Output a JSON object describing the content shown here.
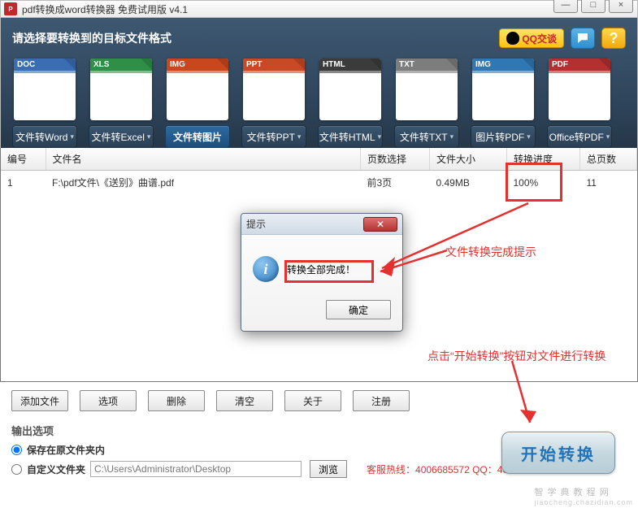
{
  "window": {
    "title": "pdf转换成word转换器 免费试用版 v4.1",
    "minimize_glyph": "—",
    "maximize_glyph": "□",
    "close_glyph": "×"
  },
  "header": {
    "title": "请选择要转换到的目标文件格式",
    "qq_label": "QQ交谈",
    "help_glyph": "?"
  },
  "formats": [
    {
      "band": "DOC",
      "band_color": "#3a6db3",
      "label": "文件转Word",
      "selected": false
    },
    {
      "band": "XLS",
      "band_color": "#2f8f47",
      "label": "文件转Excel",
      "selected": false
    },
    {
      "band": "IMG",
      "band_color": "#c8471c",
      "label": "文件转图片",
      "selected": true
    },
    {
      "band": "PPT",
      "band_color": "#c74a24",
      "label": "文件转PPT",
      "selected": false
    },
    {
      "band": "HTML",
      "band_color": "#3b3b3b",
      "label": "文件转HTML",
      "selected": false
    },
    {
      "band": "TXT",
      "band_color": "#7d7d7d",
      "label": "文件转TXT",
      "selected": false
    },
    {
      "band": "IMG",
      "band_color": "#2f78b3",
      "label": "图片转PDF",
      "selected": false
    },
    {
      "band": "PDF",
      "band_color": "#b33030",
      "label": "Office转PDF",
      "selected": false
    }
  ],
  "table": {
    "cols": {
      "num": "编号",
      "name": "文件名",
      "pages": "页数选择",
      "size": "文件大小",
      "progress": "转换进度",
      "total": "总页数"
    },
    "rows": [
      {
        "num": "1",
        "name": "F:\\pdf文件\\《送别》曲谱.pdf",
        "pages": "前3页",
        "size": "0.49MB",
        "progress": "100%",
        "total": "11"
      }
    ]
  },
  "dialog": {
    "title": "提示",
    "message": "转换全部完成！",
    "ok": "确定",
    "close_glyph": "✕"
  },
  "toolbar": {
    "add": "添加文件",
    "options": "选项",
    "delete": "删除",
    "clear": "清空",
    "about": "关于",
    "register": "注册"
  },
  "output": {
    "section_title": "输出选项",
    "opt_same": "保存在原文件夹内",
    "opt_custom": "自定义文件夹",
    "path": "C:\\Users\\Administrator\\Desktop",
    "browse": "浏览",
    "hotline": "客服热线：4006685572 QQ：4006685572",
    "watermark": "智 学 典 教 程 网",
    "watermark_sub": "jiaocheng.chazidian.com"
  },
  "start_button": "开始转换",
  "annotations": {
    "done_tip": "文件转换完成提示",
    "start_tip": "点击“开始转换”按钮对文件进行转换"
  }
}
